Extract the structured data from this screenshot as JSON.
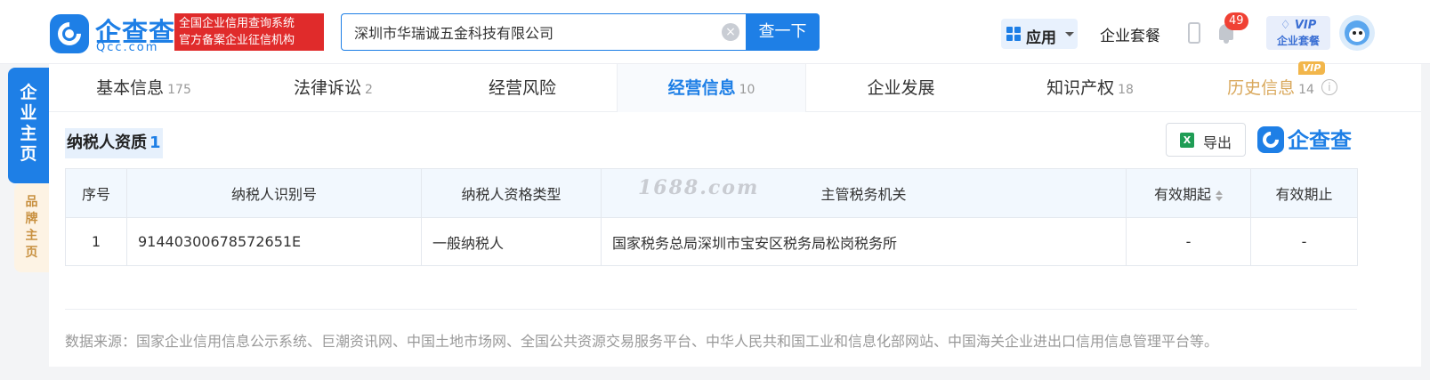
{
  "header": {
    "logo": {
      "name_cn": "企查查",
      "name_en": "Qcc.com"
    },
    "slogan": [
      "全国企业信用查询系统",
      "官方备案企业征信机构"
    ],
    "search": {
      "value": "深圳市华瑞诚五金科技有限公司",
      "button_label": "查一下"
    },
    "apps_label": "应用",
    "package_label": "企业套餐",
    "notification_count": "49",
    "vip": {
      "title": "VIP",
      "subtitle": "企业套餐"
    }
  },
  "side_tabs": {
    "main": "企业主页",
    "brand": "品牌主页"
  },
  "tabs": [
    {
      "label": "基本信息",
      "count": "175"
    },
    {
      "label": "法律诉讼",
      "count": "2"
    },
    {
      "label": "经营风险",
      "count": ""
    },
    {
      "label": "经营信息",
      "count": "10",
      "active": true
    },
    {
      "label": "企业发展",
      "count": ""
    },
    {
      "label": "知识产权",
      "count": "18"
    },
    {
      "label": "历史信息",
      "count": "14",
      "vip": true
    }
  ],
  "vip_tag": "VIP",
  "section": {
    "title": "纳税人资质",
    "count": "1"
  },
  "export_label": "导出",
  "brand_logo_text": "企查查",
  "watermark": "1688.com",
  "table": {
    "headers": [
      "序号",
      "纳税人识别号",
      "纳税人资格类型",
      "主管税务机关",
      "有效期起",
      "有效期止"
    ],
    "rows": [
      [
        "1",
        "91440300678572651E",
        "一般纳税人",
        "国家税务总局深圳市宝安区税务局松岗税务所",
        "-",
        "-"
      ]
    ]
  },
  "data_source": "数据来源：国家企业信用信息公示系统、巨潮资讯网、中国土地市场网、全国公共资源交易服务平台、中华人民共和国工业和信息化部网站、中国海关企业进出口信用信息管理平台等。",
  "colors": {
    "brand": "#1e7fe6",
    "slogan_bg": "#e02b2b",
    "vip_gold": "#d9a85c",
    "badge": "#f04134"
  }
}
